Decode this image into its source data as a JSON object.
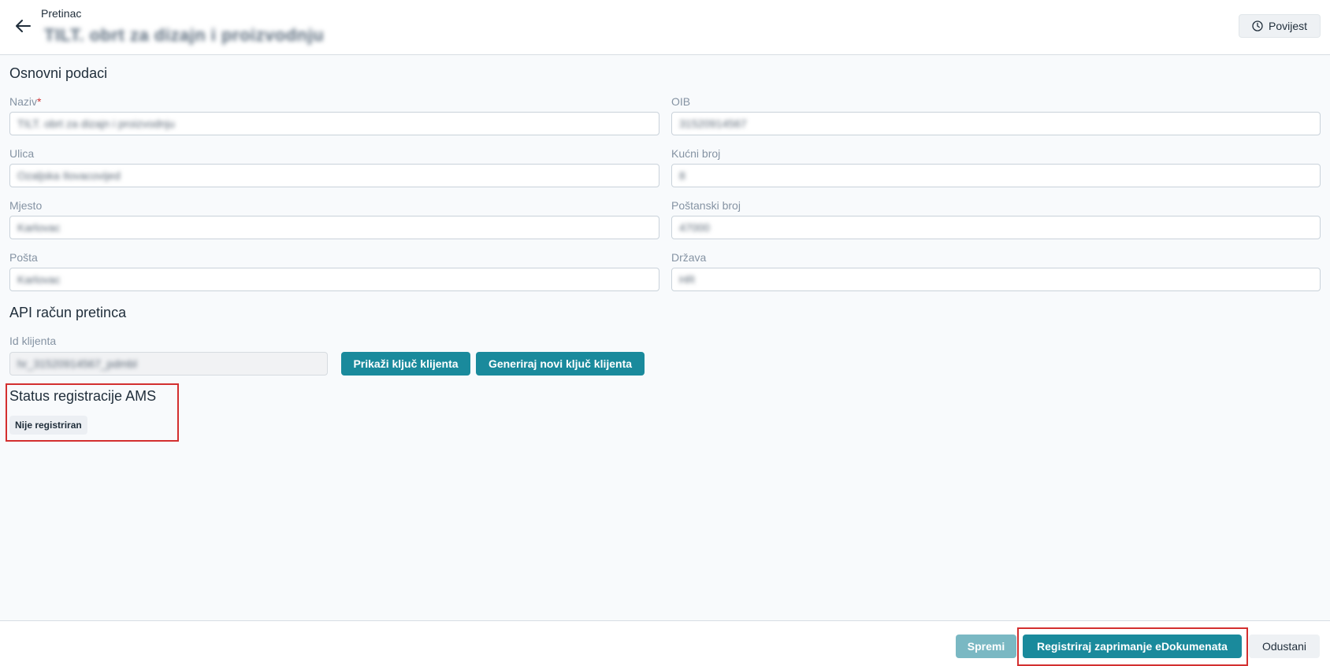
{
  "header": {
    "breadcrumb": "Pretinac",
    "title": "TILT. obrt za dizajn i proizvodnju",
    "history_label": "Povijest"
  },
  "basic": {
    "section_title": "Osnovni podaci",
    "fields": {
      "naziv": {
        "label": "Naziv",
        "required_mark": "*",
        "value": "TILT. obrt za dizajn i proizvodnju"
      },
      "oib": {
        "label": "OIB",
        "value": "31520914567"
      },
      "ulica": {
        "label": "Ulica",
        "value": "Ozaljska Ilovacovijed"
      },
      "kucni_broj": {
        "label": "Kućni broj",
        "value": "8"
      },
      "mjesto": {
        "label": "Mjesto",
        "value": "Karlovac"
      },
      "postanski_broj": {
        "label": "Poštanski broj",
        "value": "47000"
      },
      "posta": {
        "label": "Pošta",
        "value": "Karlovac"
      },
      "drzava": {
        "label": "Država",
        "value": "HR"
      }
    }
  },
  "api": {
    "section_title": "API račun pretinca",
    "client_id_label": "Id klijenta",
    "client_id_value": "hr_31520914567_pdmbl",
    "show_key_label": "Prikaži ključ klijenta",
    "generate_key_label": "Generiraj novi ključ klijenta"
  },
  "ams": {
    "section_title": "Status registracije AMS",
    "status": "Nije registriran"
  },
  "footer": {
    "save_label": "Spremi",
    "register_label": "Registriraj zaprimanje eDokumenata",
    "cancel_label": "Odustani"
  },
  "colors": {
    "accent": "#1a8a9c",
    "accent_disabled": "#7ab8c3",
    "highlight": "#d32f2f"
  },
  "icons": [
    "arrow-left-icon",
    "clock-icon"
  ]
}
